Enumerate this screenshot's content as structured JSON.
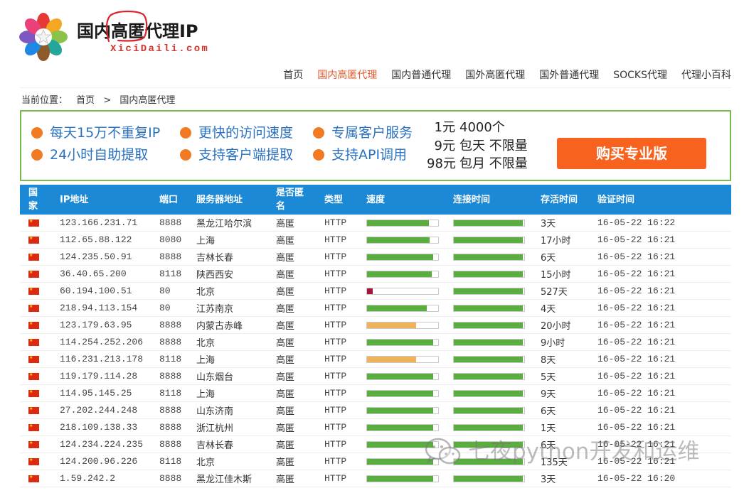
{
  "site": {
    "title": "国内高匿代理IP",
    "domain": "XiciDaili.com",
    "logo_icon": "xici-flower-logo"
  },
  "nav": {
    "items": [
      {
        "label": "首页",
        "active": false
      },
      {
        "label": "国内高匿代理",
        "active": true
      },
      {
        "label": "国内普通代理",
        "active": false
      },
      {
        "label": "国外高匿代理",
        "active": false
      },
      {
        "label": "国外普通代理",
        "active": false
      },
      {
        "label": "SOCKS代理",
        "active": false
      },
      {
        "label": "代理小百科",
        "active": false
      }
    ]
  },
  "breadcrumb": {
    "prefix": "当前位置：",
    "home": "首页",
    "separator": ">",
    "current": "国内高匿代理"
  },
  "banner": {
    "features": [
      "每天15万不重复IP",
      "更快的访问速度",
      "专属客户服务",
      "24小时自助提取",
      "支持客户端提取",
      "支持API调用"
    ],
    "pricing": [
      {
        "price": "1元",
        "desc": "4000个"
      },
      {
        "price": "9元",
        "desc": "包天 不限量"
      },
      {
        "price": "98元",
        "desc": "包月 不限量"
      }
    ],
    "buy_button": "购买专业版"
  },
  "table": {
    "headers": {
      "country": "国家",
      "ip": "IP地址",
      "port": "端口",
      "location": "服务器地址",
      "anonymity": "是否匿名",
      "type": "类型",
      "speed": "速度",
      "connect": "连接时间",
      "alive": "存活时间",
      "verified": "验证时间"
    },
    "rows": [
      {
        "country_icon": "china-flag-icon",
        "ip": "123.166.231.71",
        "port": "8888",
        "location": "黑龙江哈尔滨",
        "anonymity": "高匿",
        "type": "HTTP",
        "speed": 0.87,
        "speed_color": "#5aad3f",
        "connect": 0.98,
        "connect_color": "#5aad3f",
        "alive": "3天",
        "verified": "16-05-22 16:22"
      },
      {
        "country_icon": "china-flag-icon",
        "ip": "112.65.88.122",
        "port": "8080",
        "location": "上海",
        "anonymity": "高匿",
        "type": "HTTP",
        "speed": 0.88,
        "speed_color": "#5aad3f",
        "connect": 0.98,
        "connect_color": "#5aad3f",
        "alive": "17小时",
        "verified": "16-05-22 16:21"
      },
      {
        "country_icon": "china-flag-icon",
        "ip": "124.235.50.91",
        "port": "8888",
        "location": "吉林长春",
        "anonymity": "高匿",
        "type": "HTTP",
        "speed": 0.93,
        "speed_color": "#5aad3f",
        "connect": 0.98,
        "connect_color": "#5aad3f",
        "alive": "6天",
        "verified": "16-05-22 16:21"
      },
      {
        "country_icon": "china-flag-icon",
        "ip": "36.40.65.200",
        "port": "8118",
        "location": "陕西西安",
        "anonymity": "高匿",
        "type": "HTTP",
        "speed": 0.91,
        "speed_color": "#5aad3f",
        "connect": 0.98,
        "connect_color": "#5aad3f",
        "alive": "15小时",
        "verified": "16-05-22 16:21"
      },
      {
        "country_icon": "china-flag-icon",
        "ip": "60.194.100.51",
        "port": "80",
        "location": "北京",
        "anonymity": "高匿",
        "type": "HTTP",
        "speed": 0.08,
        "speed_color": "#a5163c",
        "connect": 0.98,
        "connect_color": "#5aad3f",
        "alive": "527天",
        "verified": "16-05-22 16:21"
      },
      {
        "country_icon": "china-flag-icon",
        "ip": "218.94.113.154",
        "port": "80",
        "location": "江苏南京",
        "anonymity": "高匿",
        "type": "HTTP",
        "speed": 0.84,
        "speed_color": "#5aad3f",
        "connect": 0.98,
        "connect_color": "#5aad3f",
        "alive": "4天",
        "verified": "16-05-22 16:21"
      },
      {
        "country_icon": "china-flag-icon",
        "ip": "123.179.63.95",
        "port": "8888",
        "location": "内蒙古赤峰",
        "anonymity": "高匿",
        "type": "HTTP",
        "speed": 0.69,
        "speed_color": "#efb45a",
        "connect": 0.98,
        "connect_color": "#5aad3f",
        "alive": "20小时",
        "verified": "16-05-22 16:21"
      },
      {
        "country_icon": "china-flag-icon",
        "ip": "114.254.252.206",
        "port": "8888",
        "location": "北京",
        "anonymity": "高匿",
        "type": "HTTP",
        "speed": 0.93,
        "speed_color": "#5aad3f",
        "connect": 0.98,
        "connect_color": "#5aad3f",
        "alive": "9小时",
        "verified": "16-05-22 16:21"
      },
      {
        "country_icon": "china-flag-icon",
        "ip": "116.231.213.178",
        "port": "8118",
        "location": "上海",
        "anonymity": "高匿",
        "type": "HTTP",
        "speed": 0.69,
        "speed_color": "#efb45a",
        "connect": 0.98,
        "connect_color": "#5aad3f",
        "alive": "8天",
        "verified": "16-05-22 16:21"
      },
      {
        "country_icon": "china-flag-icon",
        "ip": "119.179.114.28",
        "port": "8888",
        "location": "山东烟台",
        "anonymity": "高匿",
        "type": "HTTP",
        "speed": 0.93,
        "speed_color": "#5aad3f",
        "connect": 0.98,
        "connect_color": "#5aad3f",
        "alive": "5天",
        "verified": "16-05-22 16:21"
      },
      {
        "country_icon": "china-flag-icon",
        "ip": "114.95.145.25",
        "port": "8118",
        "location": "上海",
        "anonymity": "高匿",
        "type": "HTTP",
        "speed": 0.93,
        "speed_color": "#5aad3f",
        "connect": 0.98,
        "connect_color": "#5aad3f",
        "alive": "9天",
        "verified": "16-05-22 16:21"
      },
      {
        "country_icon": "china-flag-icon",
        "ip": "27.202.244.248",
        "port": "8888",
        "location": "山东济南",
        "anonymity": "高匿",
        "type": "HTTP",
        "speed": 0.93,
        "speed_color": "#5aad3f",
        "connect": 0.98,
        "connect_color": "#5aad3f",
        "alive": "6天",
        "verified": "16-05-22 16:21"
      },
      {
        "country_icon": "china-flag-icon",
        "ip": "218.109.138.33",
        "port": "8888",
        "location": "浙江杭州",
        "anonymity": "高匿",
        "type": "HTTP",
        "speed": 0.93,
        "speed_color": "#5aad3f",
        "connect": 0.98,
        "connect_color": "#5aad3f",
        "alive": "1天",
        "verified": "16-05-22 16:21"
      },
      {
        "country_icon": "china-flag-icon",
        "ip": "124.234.224.235",
        "port": "8888",
        "location": "吉林长春",
        "anonymity": "高匿",
        "type": "HTTP",
        "speed": 0.93,
        "speed_color": "#5aad3f",
        "connect": 0.98,
        "connect_color": "#5aad3f",
        "alive": "6天",
        "verified": "16-05-22 16:21"
      },
      {
        "country_icon": "china-flag-icon",
        "ip": "124.200.96.226",
        "port": "8118",
        "location": "北京",
        "anonymity": "高匿",
        "type": "HTTP",
        "speed": 0.93,
        "speed_color": "#5aad3f",
        "connect": 0.98,
        "connect_color": "#5aad3f",
        "alive": "135天",
        "verified": "16-05-22 16:21"
      },
      {
        "country_icon": "china-flag-icon",
        "ip": "1.59.242.2",
        "port": "8888",
        "location": "黑龙江佳木斯",
        "anonymity": "高匿",
        "type": "HTTP",
        "speed": 0.93,
        "speed_color": "#5aad3f",
        "connect": 0.98,
        "connect_color": "#5aad3f",
        "alive": "3天",
        "verified": "16-05-22 16:20"
      }
    ]
  },
  "watermark": {
    "text": "七夜python开发和运维",
    "icon": "wechat-icon"
  },
  "colors": {
    "nav_active": "#e4572a",
    "banner_border": "#78ba4e",
    "feature_text": "#2b72c0",
    "feature_dot": "#f27a22",
    "buy_button": "#f7621f",
    "table_header": "#1b89d6",
    "domain_red": "#d6322b"
  }
}
